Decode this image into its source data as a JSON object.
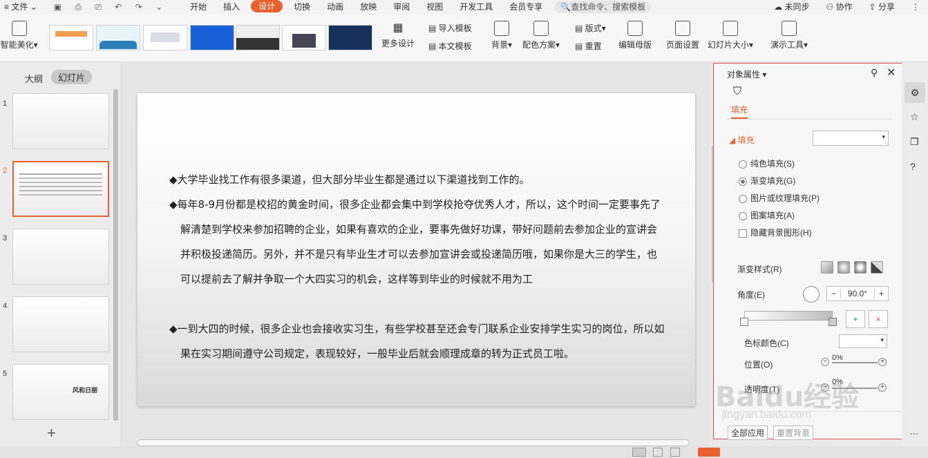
{
  "menu": {
    "file": "文件",
    "tabs": [
      "开始",
      "插入",
      "设计",
      "切换",
      "动画",
      "放映",
      "审阅",
      "视图",
      "开发工具",
      "会员专享"
    ],
    "active_tab": "设计",
    "search_placeholder": "查找命令、搜索模板",
    "right": {
      "sync": "未同步",
      "collab": "协作",
      "share": "分享"
    }
  },
  "toolbar": {
    "smart_beautify": "智能美化",
    "more_design": "更多设计",
    "import_template": "导入模板",
    "this_template": "本文模板",
    "background": "背景",
    "color_scheme": "配色方案",
    "layout": "版式",
    "reset": "重置",
    "edit_master": "编辑母版",
    "page_setup": "页面设置",
    "slide_size": "幻灯片大小",
    "presentation_tools": "演示工具"
  },
  "left_panel": {
    "tab_outline": "大纲",
    "tab_slides": "幻灯片",
    "slides": [
      {
        "num": "1",
        "text": ""
      },
      {
        "num": "2",
        "text": ""
      },
      {
        "num": "3",
        "text": ""
      },
      {
        "num": "4",
        "text": ""
      },
      {
        "num": "5",
        "text": "风和日丽"
      }
    ],
    "add": "+"
  },
  "slide": {
    "paragraphs": [
      "◆大学毕业找工作有很多渠道，但大部分毕业生都是通过以下渠道找到工作的。",
      "◆每年8-9月份都是校招的黄金时间，很多企业都会集中到学校抢夺优秀人才，所以，这个时间一定要事先了解清楚到学校来参加招聘的企业，如果有喜欢的企业，要事先做好功课，带好问题前去参加企业的宣讲会并积极投递简历。另外，并不是只有毕业生才可以去参加宣讲会或投递简历哦，如果你是大三的学生，也可以提前去了解并争取一个大四实习的机会，这样等到毕业的时候就不用为工",
      "◆一到大四的时候，很多企业也会接收实习生，有些学校甚至还会专门联系企业安排学生实习的岗位，所以如果在实习期间遵守公司规定，表现较好，一般毕业后就会顺理成章的转为正式员工啦。"
    ]
  },
  "properties": {
    "title": "对象属性",
    "tab_fill": "填充",
    "section_fill": "填充",
    "options": [
      "纯色填充(S)",
      "渐变填充(G)",
      "图片或纹理填充(P)",
      "图案填充(A)"
    ],
    "selected_option": "渐变填充(G)",
    "hide_bg": "隐藏背景图形(H)",
    "gradient_style": "渐变样式(R)",
    "angle_label": "角度(E)",
    "angle_value": "90.0°",
    "stop_color": "色标颜色(C)",
    "position_label": "位置(O)",
    "position_value": "0%",
    "transparency_label": "透明度(T)",
    "transparency_value": "0%",
    "apply_all": "全部应用",
    "reset_bg": "重置背景"
  },
  "watermark": {
    "text": "Baidu经验",
    "sub": "jingyan.baidu.com"
  },
  "colors": {
    "accent": "#e8612c",
    "selection": "#e05050"
  }
}
